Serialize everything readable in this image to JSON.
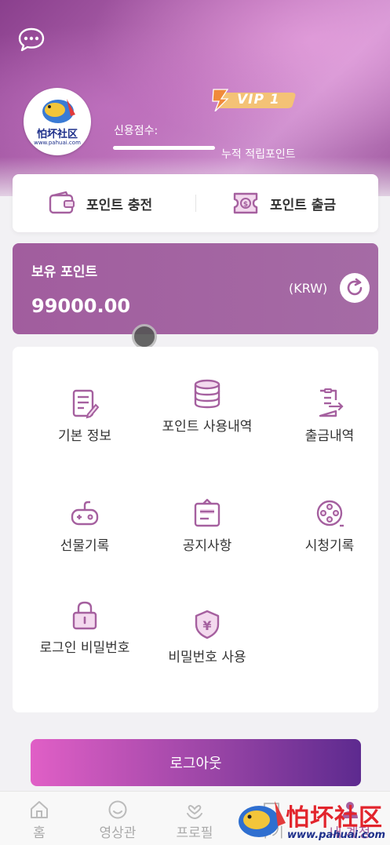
{
  "header": {
    "vip_text": "VIP 1",
    "credit_label": "신용점수:",
    "accumulated_label": "누적 적립포인트",
    "avatar_logo_text": "怕坏社区",
    "avatar_logo_url": "www.pahuai.com"
  },
  "actions": {
    "charge_label": "포인트 충전",
    "withdraw_label": "포인트 출금"
  },
  "points": {
    "title": "보유 포인트",
    "value": "99000.00",
    "unit": "(KRW)"
  },
  "menu": {
    "items": [
      {
        "label": "기본 정보",
        "icon": "document-edit-icon"
      },
      {
        "label": "포인트 사용내역",
        "icon": "database-icon"
      },
      {
        "label": "출금내역",
        "icon": "export-document-icon"
      },
      {
        "label": "선물기록",
        "icon": "gamepad-icon"
      },
      {
        "label": "공지사항",
        "icon": "clipboard-icon"
      },
      {
        "label": "시청기록",
        "icon": "film-reel-icon"
      },
      {
        "label": "로그인 비밀번호",
        "icon": "lock-icon"
      },
      {
        "label": "비밀번호 사용",
        "icon": "yen-shield-icon"
      }
    ]
  },
  "logout_label": "로그아웃",
  "nav": {
    "items": [
      {
        "label": "홈",
        "icon": "home-icon"
      },
      {
        "label": "영상관",
        "icon": "smile-icon"
      },
      {
        "label": "프로필",
        "icon": "heart-hands-icon"
      },
      {
        "label": "후기",
        "icon": "chat-icon"
      },
      {
        "label": "내 계정",
        "icon": "user-icon"
      }
    ]
  },
  "watermark": {
    "text": "怕坏社区",
    "url": "www.pahuai.com"
  },
  "colors": {
    "accent": "#a15d9e",
    "icon_purple": "#a5609f",
    "logout_start": "#e05fc6",
    "logout_end": "#5d2a8f"
  }
}
